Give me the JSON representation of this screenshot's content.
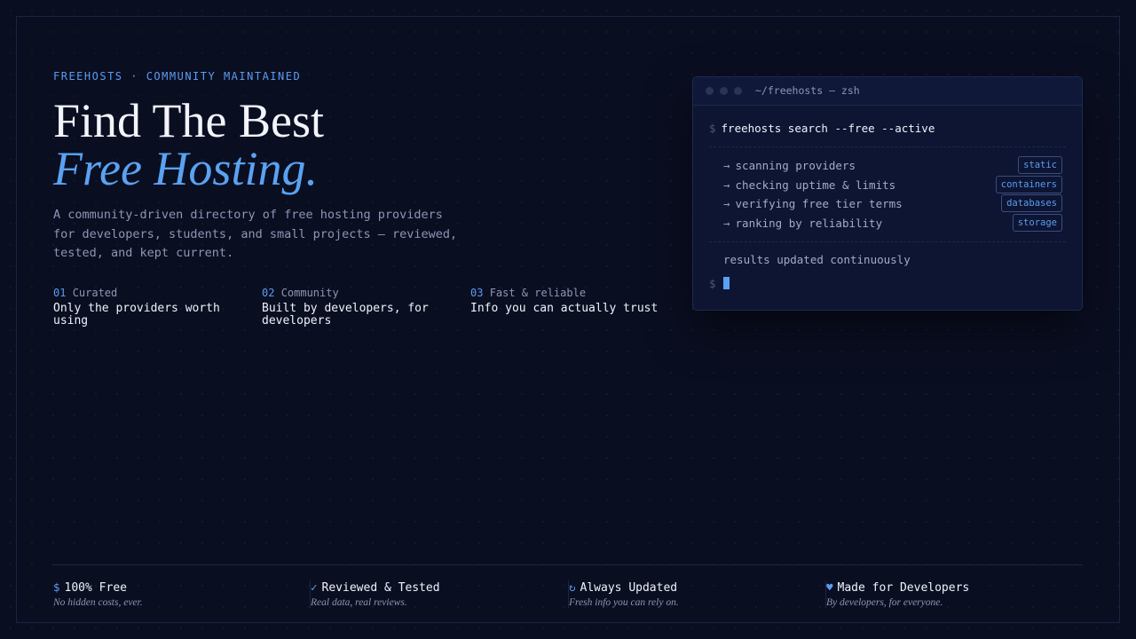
{
  "hero": {
    "eyebrow": "FREEHOSTS · COMMUNITY MAINTAINED",
    "title_line1": "Find The Best",
    "title_line2": "Free Hosting.",
    "lead": "A community-driven directory of free hosting providers for developers, students, and small projects — reviewed, tested, and kept current."
  },
  "features": [
    {
      "num": "01",
      "label": "Curated",
      "desc": "Only the providers worth using"
    },
    {
      "num": "02",
      "label": "Community",
      "desc": "Built by developers, for developers"
    },
    {
      "num": "03",
      "label": "Fast & reliable",
      "desc": "Info you can actually trust"
    }
  ],
  "terminal": {
    "title": "~/freehosts — zsh",
    "prompt": "$",
    "command": "freehosts search --free --active",
    "steps": [
      {
        "arrow": "→",
        "text": "scanning providers",
        "tag": "static"
      },
      {
        "arrow": "→",
        "text": "checking uptime & limits",
        "tag": "containers"
      },
      {
        "arrow": "→",
        "text": "verifying free tier terms",
        "tag": "databases"
      },
      {
        "arrow": "→",
        "text": "ranking by reliability",
        "tag": "storage"
      }
    ],
    "result": "results updated continuously"
  },
  "perks": [
    {
      "icon": "$",
      "icon_name": "dollar-icon",
      "title": "100% Free",
      "sub": "No hidden costs, ever."
    },
    {
      "icon": "✓",
      "icon_name": "check-icon",
      "title": "Reviewed & Tested",
      "sub": "Real data, real reviews."
    },
    {
      "icon": "↻",
      "icon_name": "refresh-icon",
      "title": "Always Updated",
      "sub": "Fresh info you can rely on."
    },
    {
      "icon": "♥",
      "icon_name": "heart-icon",
      "title": "Made for Developers",
      "sub": "By developers, for everyone."
    }
  ],
  "colors": {
    "background": "#0a0e21",
    "accent": "#5b9cf0",
    "text": "#f0f3fb",
    "muted": "#8d96b5"
  }
}
